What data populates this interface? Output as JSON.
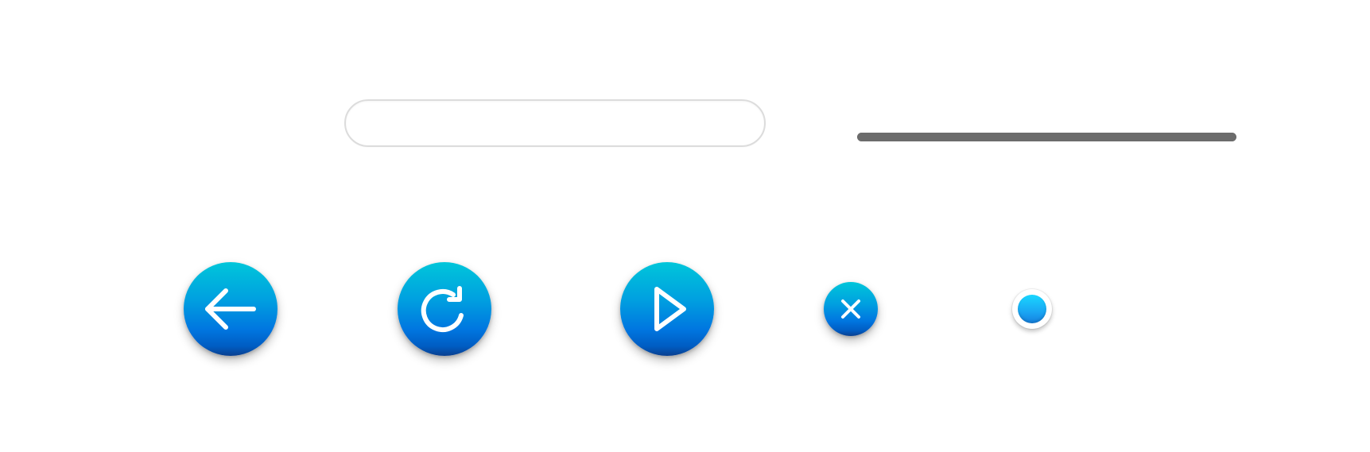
{
  "search": {
    "value": "",
    "placeholder": ""
  },
  "progress": {
    "value_percent": 100
  },
  "buttons": {
    "back": {
      "icon": "arrow-left-icon"
    },
    "reload": {
      "icon": "reload-icon"
    },
    "play": {
      "icon": "play-icon"
    },
    "close": {
      "icon": "close-icon"
    }
  },
  "radio": {
    "selected": true
  },
  "colors": {
    "accent_top": "#00c6da",
    "accent_mid": "#0076e0",
    "accent_bottom": "#0a3f8f",
    "progress_track": "#6c6c6c",
    "radio_dot": "#1aa6f3"
  }
}
